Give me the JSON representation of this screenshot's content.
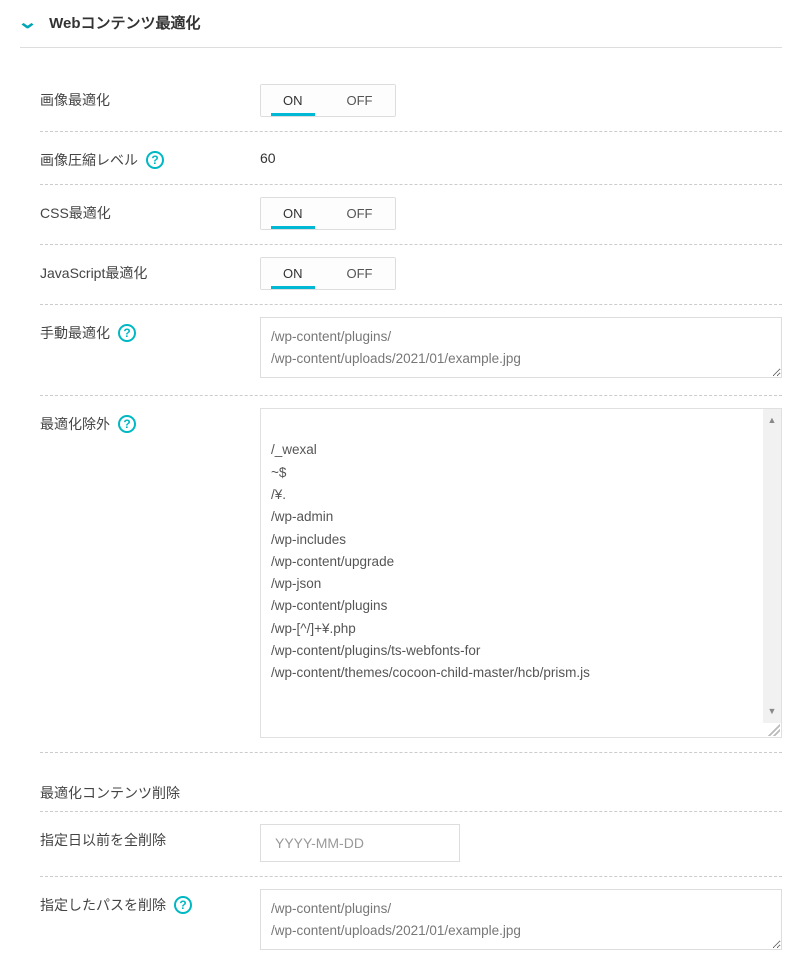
{
  "section": {
    "title": "Webコンテンツ最適化"
  },
  "rows": {
    "image_opt": {
      "label": "画像最適化",
      "on": "ON",
      "off": "OFF"
    },
    "image_level": {
      "label": "画像圧縮レベル",
      "value": "60"
    },
    "css_opt": {
      "label": "CSS最適化",
      "on": "ON",
      "off": "OFF"
    },
    "js_opt": {
      "label": "JavaScript最適化",
      "on": "ON",
      "off": "OFF"
    },
    "manual_opt": {
      "label": "手動最適化",
      "value": "/wp-content/plugins/\n/wp-content/uploads/2021/01/example.jpg"
    },
    "exclude": {
      "label": "最適化除外",
      "value": "/_wexal\n~$\n/¥.\n/wp-admin\n/wp-includes\n/wp-content/upgrade\n/wp-json\n/wp-content/plugins\n/wp-[^/]+¥.php\n/wp-content/plugins/ts-webfonts-for\n/wp-content/themes/cocoon-child-master/hcb/prism.js"
    },
    "delete_section": {
      "label": "最適化コンテンツ削除"
    },
    "delete_before": {
      "label": "指定日以前を全削除",
      "placeholder": "YYYY-MM-DD"
    },
    "delete_path": {
      "label": "指定したパスを削除",
      "value": "/wp-content/plugins/\n/wp-content/uploads/2021/01/example.jpg"
    }
  }
}
